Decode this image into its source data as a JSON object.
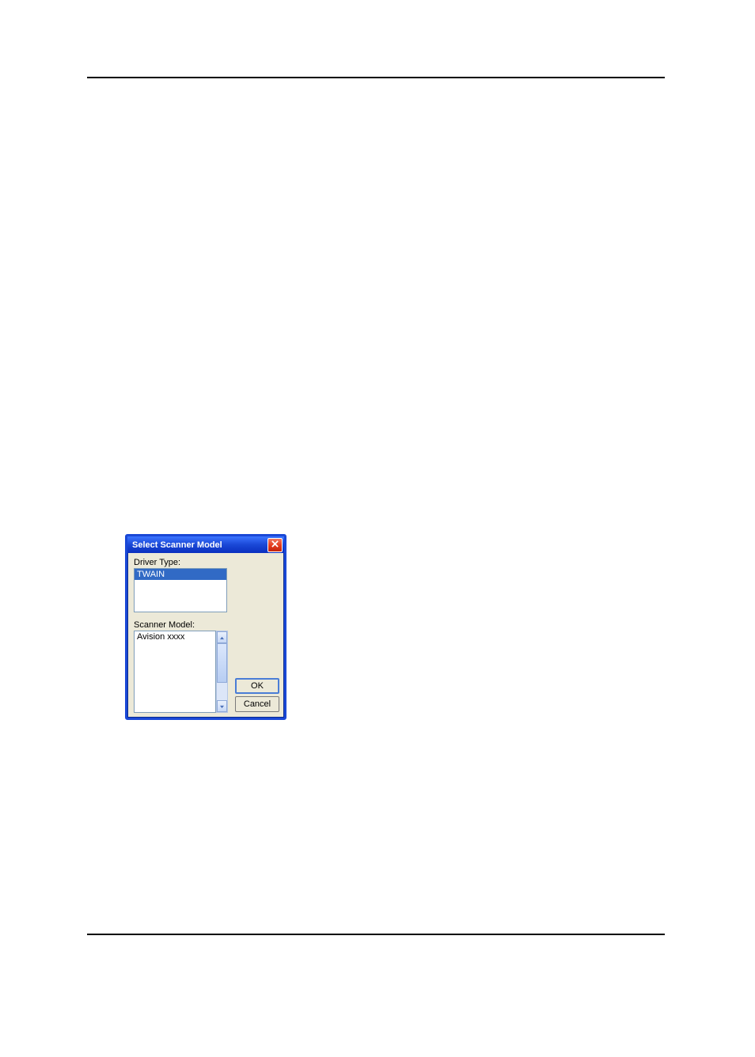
{
  "dialog": {
    "title": "Select Scanner Model",
    "driver_label": "Driver Type:",
    "driver_items": {
      "selected": "TWAIN"
    },
    "scanner_label": "Scanner Model:",
    "scanner_items": {
      "item0": "Avision xxxx"
    },
    "ok_label": "OK",
    "cancel_label": "Cancel"
  }
}
